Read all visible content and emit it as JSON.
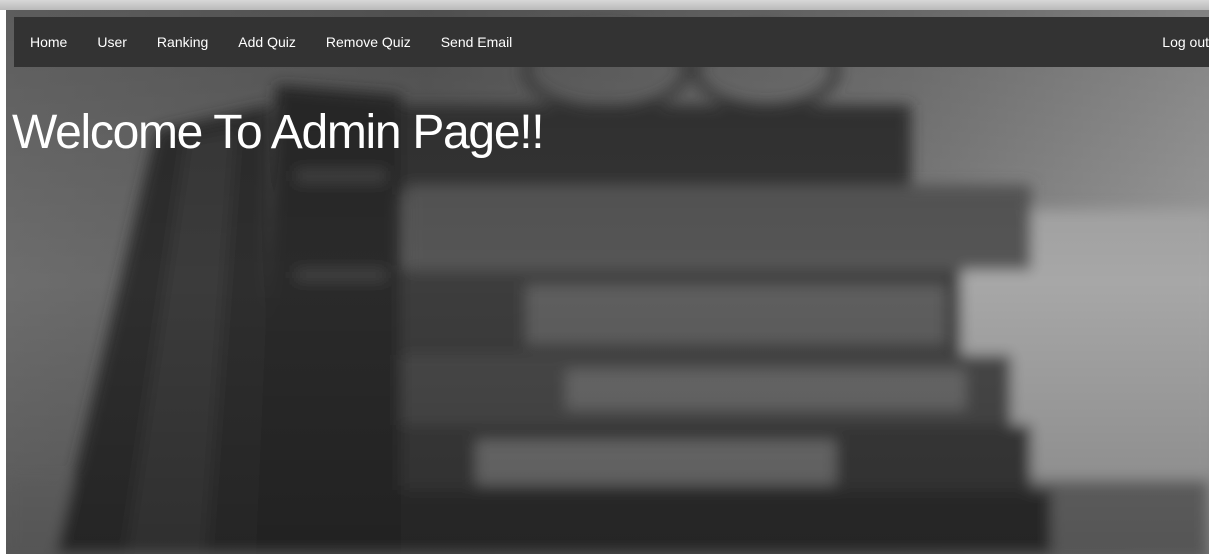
{
  "navbar": {
    "items": [
      {
        "label": "Home"
      },
      {
        "label": "User"
      },
      {
        "label": "Ranking"
      },
      {
        "label": "Add Quiz"
      },
      {
        "label": "Remove Quiz"
      },
      {
        "label": "Send Email"
      }
    ],
    "logout_label": "Log out"
  },
  "main": {
    "heading": "Welcome To Admin Page!!"
  },
  "colors": {
    "navbar_bg": "#333333",
    "nav_text": "#ffffff",
    "heading_text": "#ffffff"
  },
  "background_image": "blurred-stack-of-books-photo"
}
